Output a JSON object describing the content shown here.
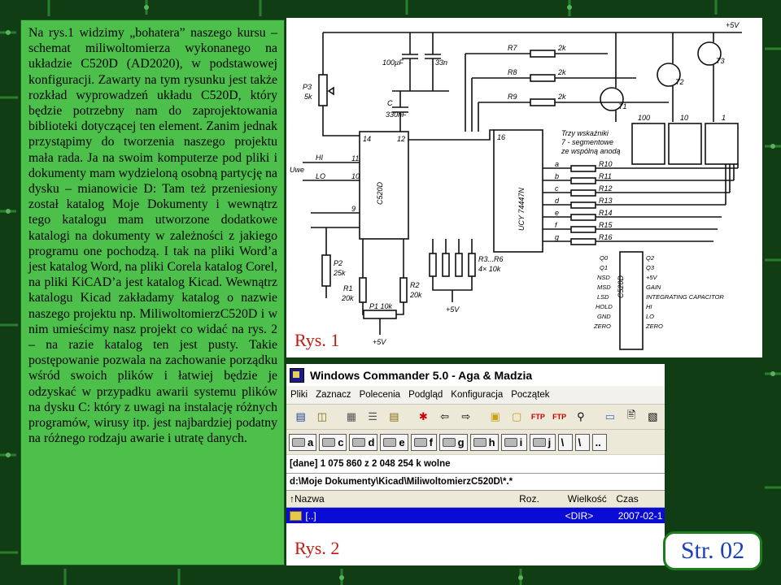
{
  "article": {
    "paragraph": "Na rys.1 widzimy „bohatera” naszego kursu – schemat miliwoltomierza wykonanego na układzie C520D (AD2020), w podstawowej konfiguracji. Zawarty na tym rysunku jest także rozkład wyprowadzeń układu C520D, który będzie potrzebny nam do zaprojektowania biblioteki dotyczącej ten element. Zanim jednak przystąpimy do tworzenia naszego projektu mała rada. Ja na swoim komputerze pod pliki i dokumenty mam wydzieloną osobną partycję na dysku – mianowicie D: Tam też przeniesiony został katalog Moje Dokumenty i wewnątrz tego katalogu mam utworzone dodatkowe katalogi na dokumenty w zależności z jakiego programu one pochodzą. I tak na pliki Word’a jest katalog Word, na pliki Corela katalog Corel, na pliki KiCAD’a jest katalog Kicad. Wewnątrz katalogu Kicad zakładamy katalog o nazwie naszego projektu np. MiliwoltomierzC520D i w nim umieścimy nasz projekt co widać na rys. 2 – na razie katalog ten jest pusty. Takie postępowanie pozwala na zachowanie porządku wśród swoich plików i łatwiej będzie je odzyskać w przypadku awarii systemu plików na dysku C: który z uwagi na instalację różnych programów, wirusy itp. jest najbardziej podatny na różnego rodzaju awarie i utratę danych."
  },
  "figure1": {
    "caption": "Rys. 1",
    "labels": {
      "supply": "+5V",
      "c1": "100µF",
      "c2": "33n",
      "c3": "C",
      "c3v": "330nF",
      "p3": "P3",
      "p3v": "5k",
      "hi": "HI",
      "lo": "LO",
      "uwe": "Uwe",
      "ic1": "C520D",
      "ic2": "UCY 74447N",
      "r7": "R7",
      "r8": "R8",
      "r9": "R9",
      "r7v": "2k",
      "r8v": "2k",
      "r9v": "2k",
      "t1": "T1",
      "t2": "T2",
      "t3": "T3",
      "d100": "100",
      "d10": "10",
      "d1": "1",
      "note1": "Trzy wskaźniki",
      "note2": "7 - segmentowe",
      "note3": "ze wspólną anodą",
      "r10": "R10",
      "r11": "R11",
      "r12": "R12",
      "r13": "R13",
      "r14": "R14",
      "r15": "R15",
      "r16": "R16",
      "seg_a": "a",
      "seg_b": "b",
      "seg_c": "c",
      "seg_d": "d",
      "seg_e": "e",
      "seg_f": "f",
      "seg_g": "g",
      "pin14": "14",
      "pin12": "12",
      "pin16": "16",
      "pin11": "11",
      "pin10": "10",
      "pin9": "9",
      "p2": "P2",
      "p2v": "25k",
      "r1": "R1",
      "r1v": "20k",
      "r2": "R2",
      "r2v": "20k",
      "p1": "P1 10k",
      "r3r6": "R3...R6",
      "r3r6v": "4× 10k",
      "plus5a": "+5V",
      "plus5b": "+5V",
      "pin_q0": "Q0",
      "pin_q1": "Q1",
      "pin_q2": "Q2",
      "pin_q3": "Q3",
      "pin_gain": "GAIN",
      "pin_intcap": "INTEGRATING CAPACITOR",
      "pin_hi": "HI",
      "pin_lo": "LO",
      "pin_gnd": "GND",
      "pin_zero_l": "ZERO",
      "pin_zero_r": "ZERO",
      "pin_nsd": "NSD",
      "pin_msd": "MSD",
      "pin_lsd": "LSD",
      "pin_hold": "HOLD",
      "pin_v5": "+5V",
      "pin_ic": "C520D"
    }
  },
  "figure2": {
    "caption": "Rys. 2",
    "title": "Windows Commander 5.0 - Aga & Madzia",
    "menu": [
      "Pliki",
      "Zaznacz",
      "Polecenia",
      "Podgląd",
      "Konfiguracja",
      "Początek"
    ],
    "drives": [
      "a",
      "c",
      "d",
      "e",
      "f",
      "g",
      "h",
      "i",
      "j",
      "\\",
      "\\",
      ".."
    ],
    "drive_info": "[dane]  1 075 860 z 2 048 254 k wolne",
    "path": "d:\\Moje Dokumenty\\Kicad\\MiliwoltomierzC520D\\*.*",
    "columns": {
      "name": "↑Nazwa",
      "ext": "Roz.",
      "size": "Wielkość",
      "date": "Czas"
    },
    "row": {
      "name": "[..]",
      "size": "<DIR>",
      "date": "2007-02-1"
    }
  },
  "page": {
    "number": "Str. 02"
  }
}
